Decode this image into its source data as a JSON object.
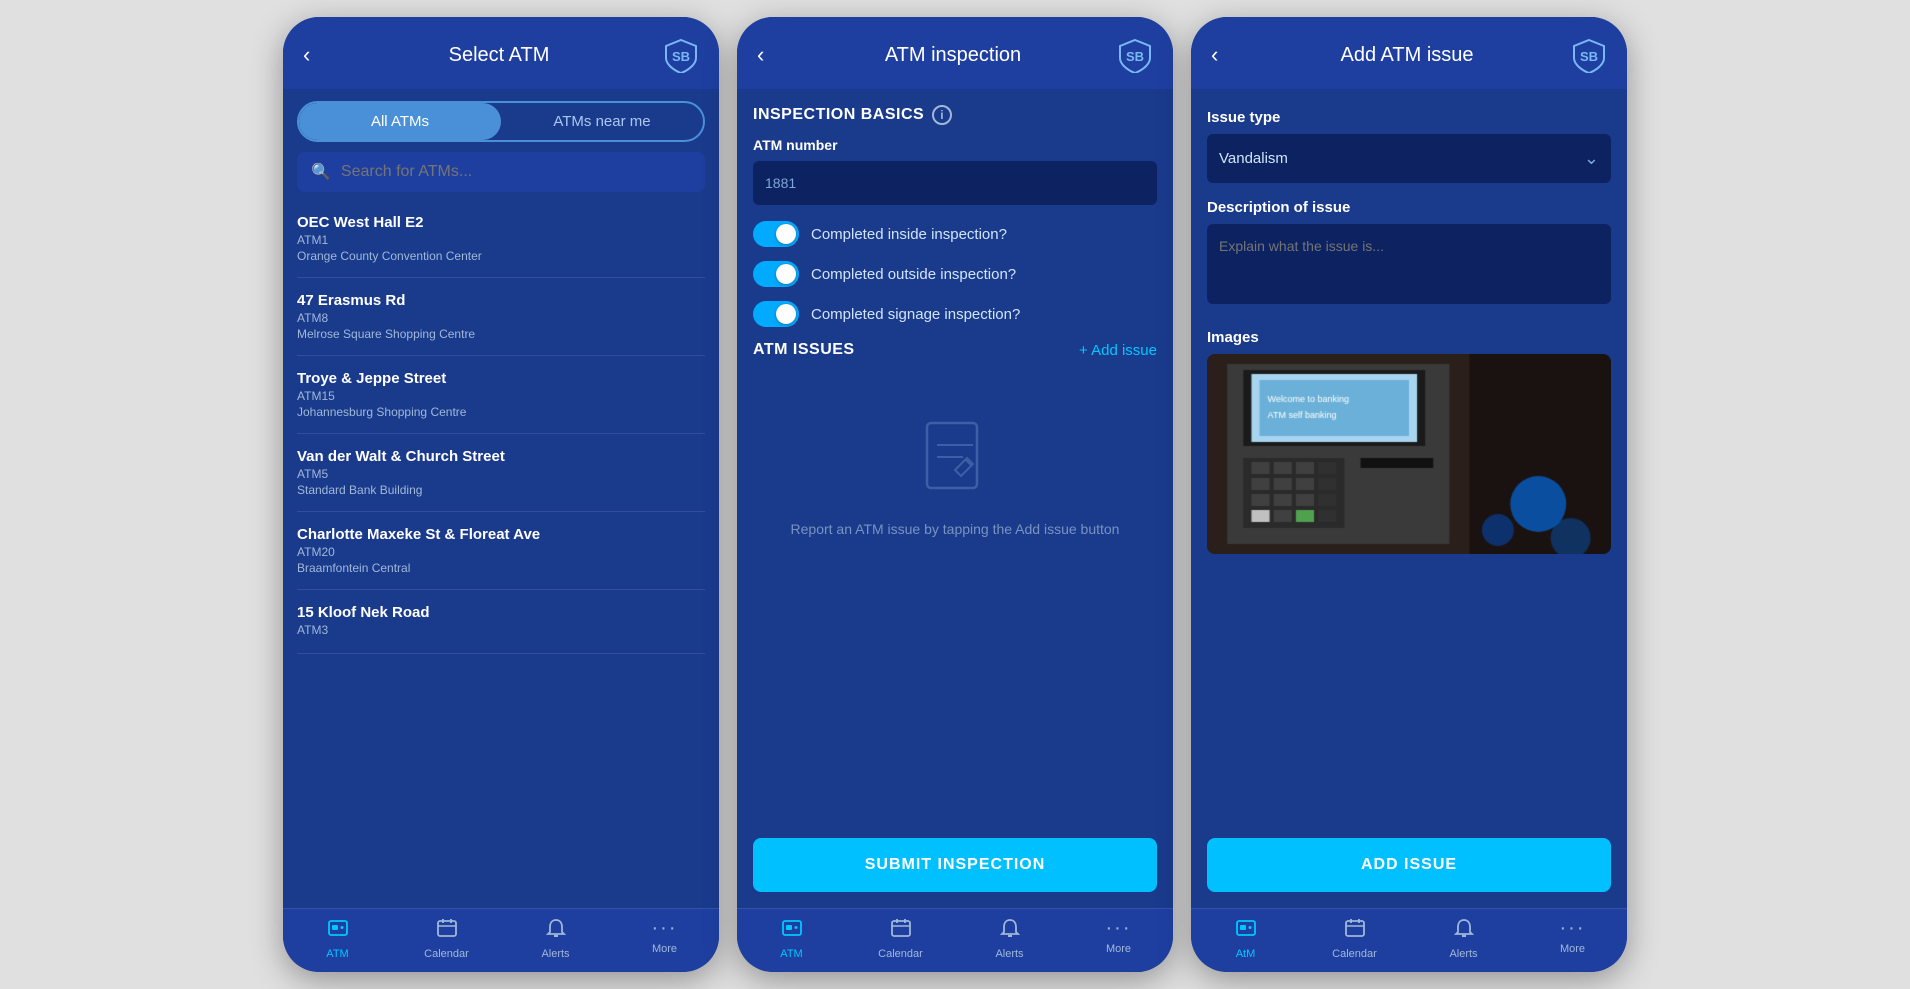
{
  "screen1": {
    "header": {
      "title": "Select ATM",
      "back_label": "‹"
    },
    "tabs": [
      {
        "id": "all",
        "label": "All ATMs",
        "active": true
      },
      {
        "id": "near",
        "label": "ATMs near me",
        "active": false
      }
    ],
    "search": {
      "placeholder": "Search for ATMs..."
    },
    "atms": [
      {
        "name": "OEC West Hall E2",
        "code": "ATM1",
        "location": "Orange County Convention Center"
      },
      {
        "name": "47 Erasmus Rd",
        "code": "ATM8",
        "location": "Melrose Square Shopping Centre"
      },
      {
        "name": "Troye & Jeppe Street",
        "code": "ATM15",
        "location": "Johannesburg Shopping Centre"
      },
      {
        "name": "Van der Walt & Church Street",
        "code": "ATM5",
        "location": "Standard Bank Building"
      },
      {
        "name": "Charlotte Maxeke St & Floreat Ave",
        "code": "ATM20",
        "location": "Braamfontein Central"
      },
      {
        "name": "15 Kloof Nek Road",
        "code": "ATM3",
        "location": ""
      }
    ],
    "nav": [
      {
        "icon": "🏧",
        "label": "ATM",
        "active": true
      },
      {
        "icon": "📅",
        "label": "Calendar",
        "active": false
      },
      {
        "icon": "🔔",
        "label": "Alerts",
        "active": false
      },
      {
        "icon": "···",
        "label": "More",
        "active": false
      }
    ]
  },
  "screen2": {
    "header": {
      "title": "ATM inspection",
      "back_label": "‹"
    },
    "inspection_basics_label": "INSPECTION BASICS",
    "atm_number_label": "ATM number",
    "atm_number_value": "1881",
    "toggles": [
      {
        "label": "Completed inside inspection?",
        "on": true
      },
      {
        "label": "Completed outside inspection?",
        "on": true
      },
      {
        "label": "Completed signage inspection?",
        "on": true
      }
    ],
    "atm_issues_label": "ATM ISSUES",
    "add_issue_label": "+ Add issue",
    "empty_text": "Report an ATM issue by\ntapping the Add issue button",
    "submit_label": "SUBMIT INSPECTION",
    "nav": [
      {
        "icon": "🏧",
        "label": "ATM",
        "active": true
      },
      {
        "icon": "📅",
        "label": "Calendar",
        "active": false
      },
      {
        "icon": "🔔",
        "label": "Alerts",
        "active": false
      },
      {
        "icon": "···",
        "label": "More",
        "active": false
      }
    ]
  },
  "screen3": {
    "header": {
      "title": "Add ATM issue",
      "back_label": "‹"
    },
    "issue_type_label": "Issue type",
    "issue_type_value": "Vandalism",
    "description_label": "Description of issue",
    "description_placeholder": "Explain what the issue is...",
    "images_label": "Images",
    "add_issue_btn_label": "ADD ISSUE",
    "nav": [
      {
        "icon": "🏧",
        "label": "AtM",
        "active": true
      },
      {
        "icon": "📅",
        "label": "Calendar",
        "active": false
      },
      {
        "icon": "🔔",
        "label": "Alerts",
        "active": false
      },
      {
        "icon": "···",
        "label": "More",
        "active": false
      }
    ]
  }
}
